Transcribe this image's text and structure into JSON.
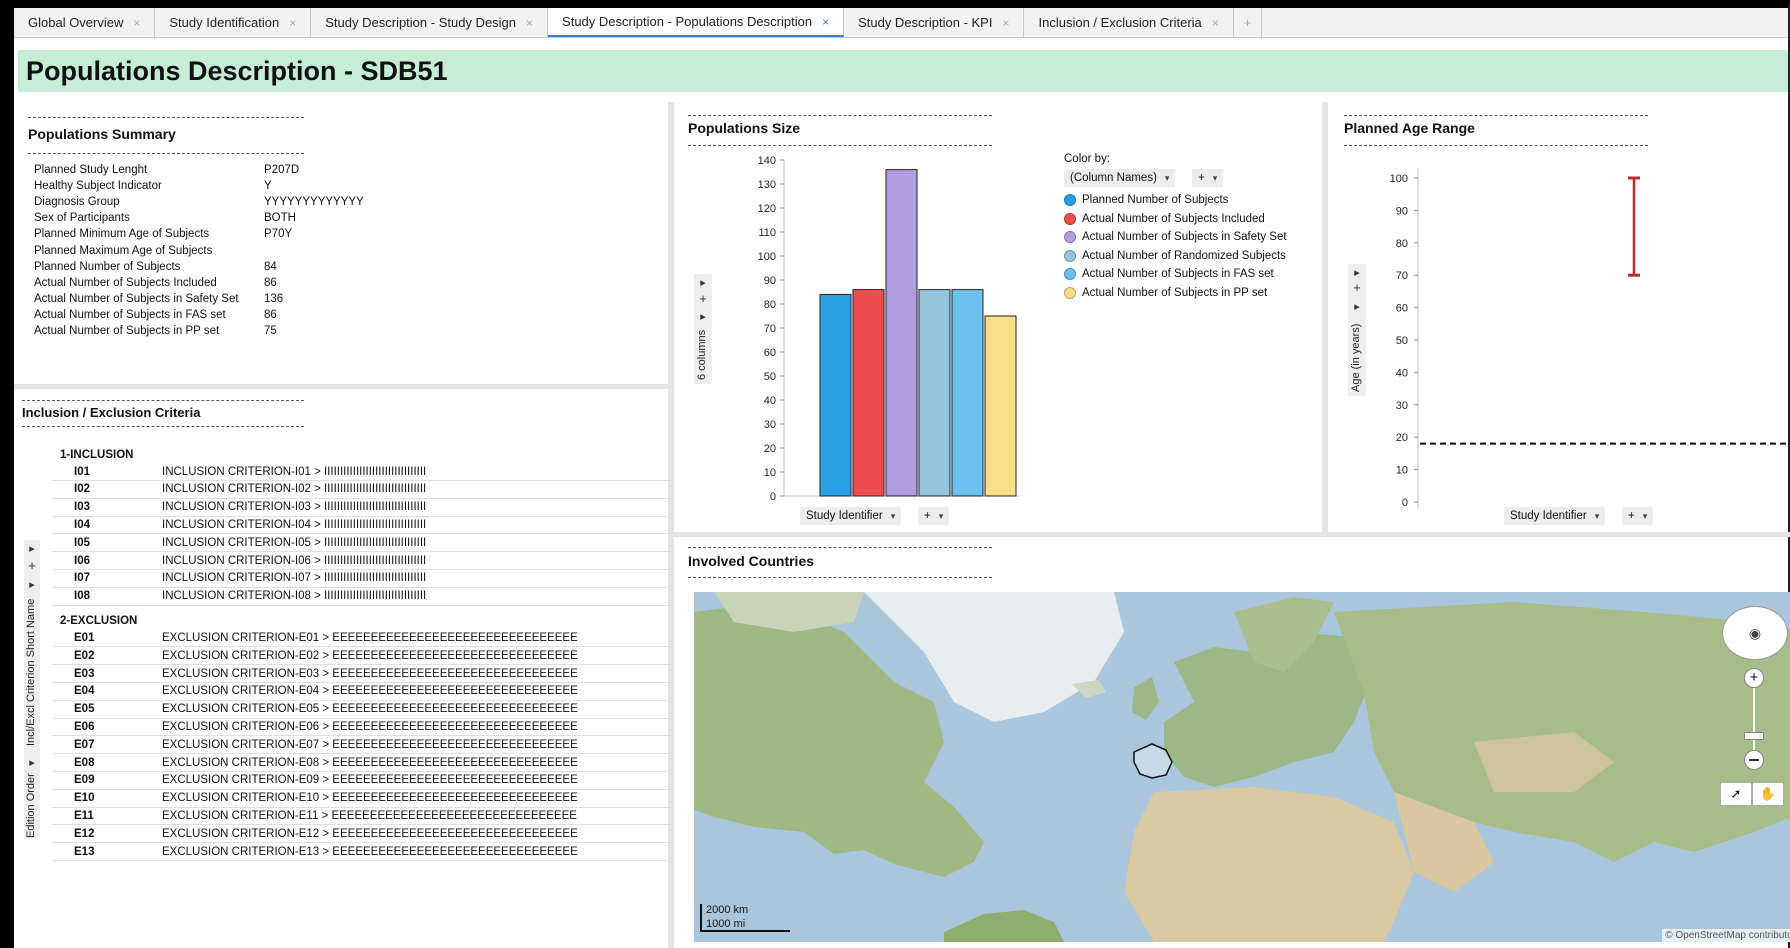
{
  "tabs": [
    {
      "label": "Global Overview",
      "active": false
    },
    {
      "label": "Study Identification",
      "active": false
    },
    {
      "label": "Study Description - Study Design",
      "active": false
    },
    {
      "label": "Study Description - Populations Description",
      "active": true
    },
    {
      "label": "Study Description - KPI",
      "active": false
    },
    {
      "label": "Inclusion / Exclusion Criteria",
      "active": false
    }
  ],
  "tab_close_glyph": "×",
  "tab_add_glyph": "+",
  "page_title": "Populations Description - SDB51",
  "summary": {
    "title": "Populations Summary",
    "rows": [
      {
        "key": "Planned Study Lenght",
        "value": "P207D"
      },
      {
        "key": "Healthy Subject Indicator",
        "value": "Y"
      },
      {
        "key": "Diagnosis Group",
        "value": "YYYYYYYYYYYYY"
      },
      {
        "key": "Sex of Participants",
        "value": "BOTH"
      },
      {
        "key": "Planned Minimum Age of Subjects",
        "value": "P70Y"
      },
      {
        "key": "Planned Maximum Age of Subjects",
        "value": ""
      },
      {
        "key": "Planned Number of Subjects",
        "value": "84"
      },
      {
        "key": "Actual Number of Subjects Included",
        "value": "86"
      },
      {
        "key": "Actual Number of Subjects in Safety Set",
        "value": "136"
      },
      {
        "key": "Actual Number of Subjects in FAS set",
        "value": "86"
      },
      {
        "key": "Actual Number of Subjects in PP set",
        "value": "75"
      }
    ]
  },
  "criteria": {
    "title": "Inclusion / Exclusion Criteria",
    "axis_label_1": "Incl/Excl Criterion Short Name",
    "axis_label_2": "Edition Order",
    "groups": [
      {
        "label": "1-INCLUSION",
        "items": [
          {
            "id": "I01",
            "text": "INCLUSION CRITERION-I01 > IIIIIIIIIIIIIIIIIIIIIIIIIIIIIIII"
          },
          {
            "id": "I02",
            "text": "INCLUSION CRITERION-I02 > IIIIIIIIIIIIIIIIIIIIIIIIIIIIIIII"
          },
          {
            "id": "I03",
            "text": "INCLUSION CRITERION-I03 > IIIIIIIIIIIIIIIIIIIIIIIIIIIIIIII"
          },
          {
            "id": "I04",
            "text": "INCLUSION CRITERION-I04 > IIIIIIIIIIIIIIIIIIIIIIIIIIIIIIII"
          },
          {
            "id": "I05",
            "text": "INCLUSION CRITERION-I05 > IIIIIIIIIIIIIIIIIIIIIIIIIIIIIIII"
          },
          {
            "id": "I06",
            "text": "INCLUSION CRITERION-I06 > IIIIIIIIIIIIIIIIIIIIIIIIIIIIIIII"
          },
          {
            "id": "I07",
            "text": "INCLUSION CRITERION-I07 > IIIIIIIIIIIIIIIIIIIIIIIIIIIIIIII"
          },
          {
            "id": "I08",
            "text": "INCLUSION CRITERION-I08 > IIIIIIIIIIIIIIIIIIIIIIIIIIIIIIII"
          }
        ]
      },
      {
        "label": "2-EXCLUSION",
        "items": [
          {
            "id": "E01",
            "text": "EXCLUSION CRITERION-E01 > EEEEEEEEEEEEEEEEEEEEEEEEEEEEEEEE"
          },
          {
            "id": "E02",
            "text": "EXCLUSION CRITERION-E02 > EEEEEEEEEEEEEEEEEEEEEEEEEEEEEEEE"
          },
          {
            "id": "E03",
            "text": "EXCLUSION CRITERION-E03 > EEEEEEEEEEEEEEEEEEEEEEEEEEEEEEEE"
          },
          {
            "id": "E04",
            "text": "EXCLUSION CRITERION-E04 > EEEEEEEEEEEEEEEEEEEEEEEEEEEEEEEE"
          },
          {
            "id": "E05",
            "text": "EXCLUSION CRITERION-E05 > EEEEEEEEEEEEEEEEEEEEEEEEEEEEEEEE"
          },
          {
            "id": "E06",
            "text": "EXCLUSION CRITERION-E06 > EEEEEEEEEEEEEEEEEEEEEEEEEEEEEEEE"
          },
          {
            "id": "E07",
            "text": "EXCLUSION CRITERION-E07 > EEEEEEEEEEEEEEEEEEEEEEEEEEEEEEEE"
          },
          {
            "id": "E08",
            "text": "EXCLUSION CRITERION-E08 > EEEEEEEEEEEEEEEEEEEEEEEEEEEEEEEE"
          },
          {
            "id": "E09",
            "text": "EXCLUSION CRITERION-E09 > EEEEEEEEEEEEEEEEEEEEEEEEEEEEEEEE"
          },
          {
            "id": "E10",
            "text": "EXCLUSION CRITERION-E10 > EEEEEEEEEEEEEEEEEEEEEEEEEEEEEEEE"
          },
          {
            "id": "E11",
            "text": "EXCLUSION CRITERION-E11 > EEEEEEEEEEEEEEEEEEEEEEEEEEEEEEEE"
          },
          {
            "id": "E12",
            "text": "EXCLUSION CRITERION-E12 > EEEEEEEEEEEEEEEEEEEEEEEEEEEEEEEE"
          },
          {
            "id": "E13",
            "text": "EXCLUSION CRITERION-E13 > EEEEEEEEEEEEEEEEEEEEEEEEEEEEEEEE"
          }
        ]
      }
    ]
  },
  "pop_size": {
    "title": "Populations Size",
    "axis_side_label": "6 columns",
    "x_selector": "Study Identifier",
    "color_by_label": "Color by:",
    "color_by_value": "(Column Names)"
  },
  "age_range": {
    "title": "Planned Age Range",
    "y_side_label": "Age (in years)",
    "x_selector": "Study Identifier"
  },
  "map": {
    "title": "Involved Countries",
    "scale_km": "2000 km",
    "scale_mi": "1000 mi",
    "attribution": "© OpenStreetMap contributors"
  },
  "ui_glyphs": {
    "expand": "▸",
    "plus": "+",
    "caret": "▾"
  },
  "colors": {
    "title_bg": "#c6eed6",
    "active_tab": "#3a7bd5",
    "age_bar": "#c0282e"
  },
  "chart_data": [
    {
      "type": "bar",
      "title": "Populations Size",
      "xlabel": "Study Identifier",
      "ylim": [
        0,
        140
      ],
      "yticks": [
        0,
        10,
        20,
        30,
        40,
        50,
        60,
        70,
        80,
        90,
        100,
        110,
        120,
        130,
        140
      ],
      "series": [
        {
          "name": "Planned Number of Subjects",
          "values": [
            84
          ],
          "color": "#2a9fe6"
        },
        {
          "name": "Actual Number of Subjects Included",
          "values": [
            86
          ],
          "color": "#ef4d4d"
        },
        {
          "name": "Actual Number of Subjects in Safety Set",
          "values": [
            136
          ],
          "color": "#b09ee0"
        },
        {
          "name": "Actual Number of Randomized Subjects",
          "values": [
            86
          ],
          "color": "#93c6dc"
        },
        {
          "name": "Actual Number of Subjects in FAS set",
          "values": [
            86
          ],
          "color": "#6cc1f1"
        },
        {
          "name": "Actual Number of Subjects in PP set",
          "values": [
            75
          ],
          "color": "#f7de87"
        }
      ]
    },
    {
      "type": "range",
      "title": "Planned Age Range",
      "ylabel": "Age (in years)",
      "xlabel": "Study Identifier",
      "ylim": [
        0,
        100
      ],
      "yticks": [
        0,
        10,
        20,
        30,
        40,
        50,
        60,
        70,
        80,
        90,
        100
      ],
      "range": {
        "min": 70,
        "max": 100
      },
      "reference_line": 18
    }
  ]
}
